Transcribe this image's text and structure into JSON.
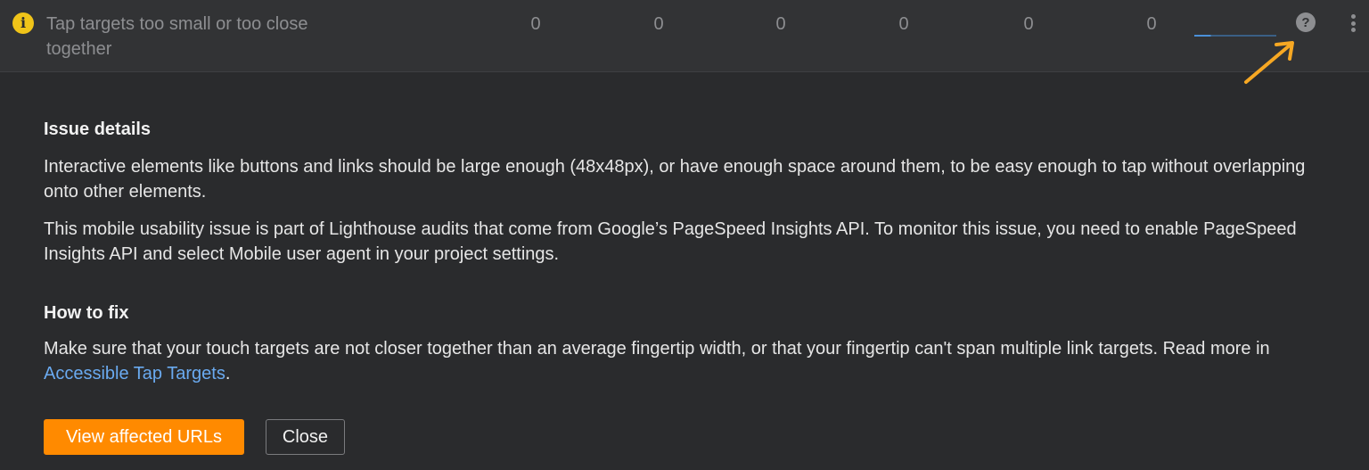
{
  "issue": {
    "icon": "info-icon",
    "title": "Tap targets too small or too close together",
    "counts": [
      "0",
      "0",
      "0",
      "0",
      "0",
      "0"
    ],
    "help_icon": "question-mark-icon",
    "more_icon": "vertical-dots-icon"
  },
  "details": {
    "heading": "Issue details",
    "paragraph_1": "Interactive elements like buttons and links should be large enough (48x48px), or have enough space around them, to be easy enough to tap without overlapping onto other elements.",
    "paragraph_2": "This mobile usability issue is part of Lighthouse audits that come from Google’s PageSpeed Insights API. To monitor this issue, you need to enable PageSpeed Insights API and select Mobile user agent in your project settings."
  },
  "fix": {
    "heading": "How to fix",
    "text_before_link": "Make sure that your touch targets are not closer together than an average fingertip width, or that your fingertip can't span multiple link targets. Read more in ",
    "link_text": "Accessible Tap Targets",
    "text_after_link": "."
  },
  "actions": {
    "primary_label": "View affected URLs",
    "secondary_label": "Close"
  },
  "colors": {
    "accent": "#ff8a00",
    "annotation_arrow": "#f7a823",
    "link": "#6aaaf0",
    "info": "#f0c419"
  }
}
